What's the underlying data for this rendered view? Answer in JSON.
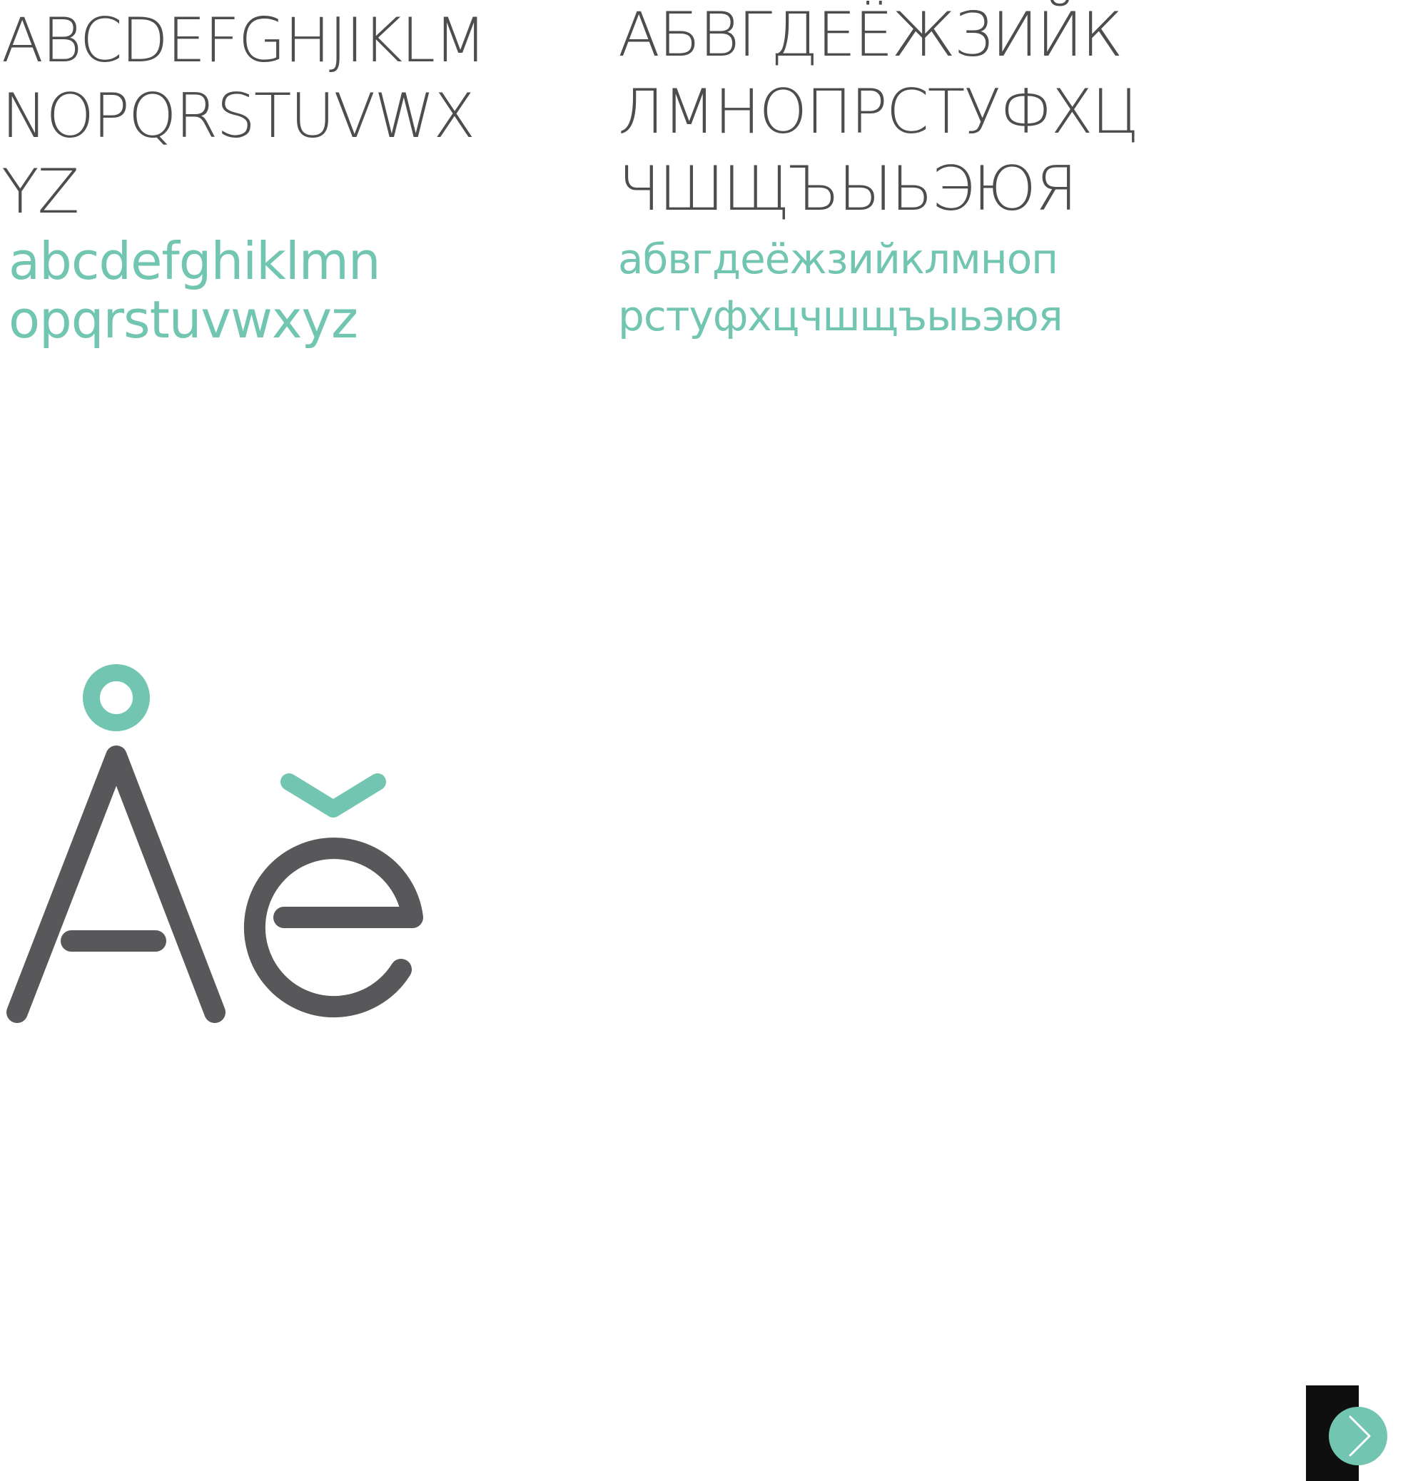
{
  "latin": {
    "upper_lines": [
      "ABCDEFGHJIKLM",
      "NOPQRSTUVWX",
      "YZ"
    ],
    "lower_lines": [
      "abcdefghiklmn",
      "opqrstuvwxyz"
    ]
  },
  "cyrillic": {
    "upper_lines": [
      "АБВГДЕЁЖЗИЙК",
      "ЛМНОПРСТУФХЦ",
      "ЧШЩЪЫЬЭЮЯ"
    ],
    "lower_lines": [
      "абвгдеёжзийклмноп",
      "рстуфхцчшщъыьэюя"
    ]
  },
  "colors": {
    "text_dark": "#4d4d4f",
    "accent_teal": "#72c6b1",
    "nav_panel": "#0f0f0f"
  },
  "showcase": {
    "glyphs": [
      "Å",
      "ĕ"
    ]
  },
  "navigation": {
    "next_icon": "chevron-right-icon"
  }
}
